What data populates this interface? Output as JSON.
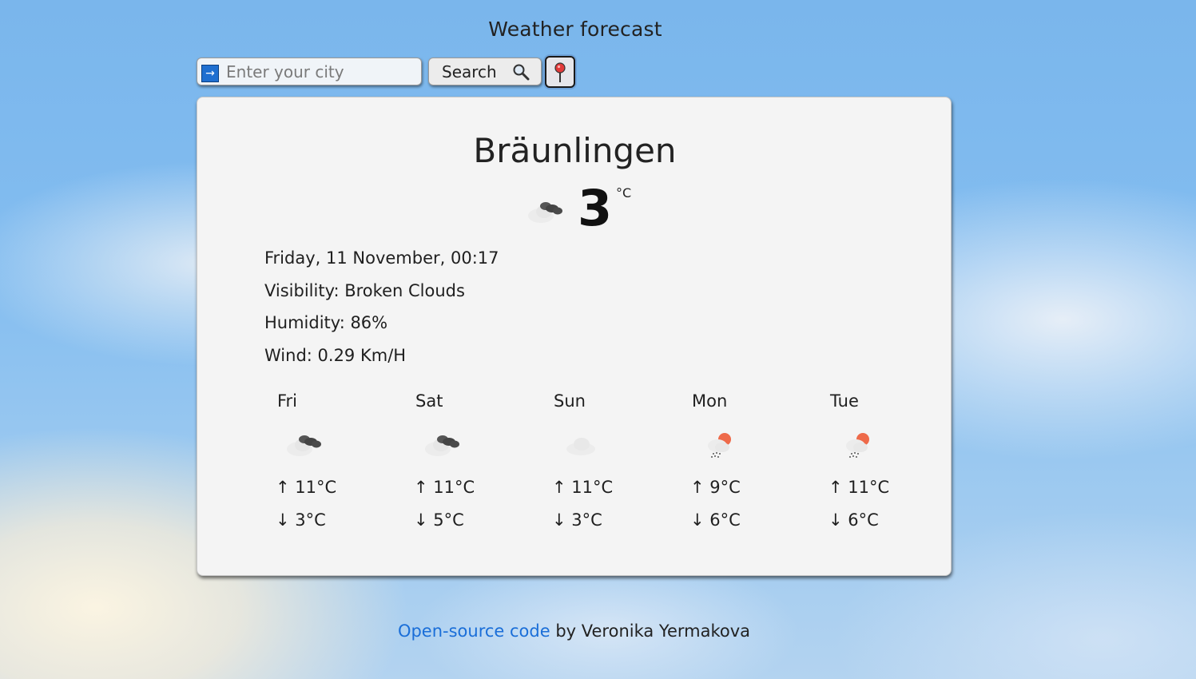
{
  "header": {
    "title": "Weather forecast"
  },
  "search": {
    "placeholder": "Enter your city",
    "value": "",
    "button_label": "Search",
    "enter_icon": "arrow-right-icon",
    "search_icon": "magnifier-icon",
    "location_icon": "location-pin-icon"
  },
  "current": {
    "city": "Bräunlingen",
    "temperature": "3",
    "unit": "°C",
    "icon": "broken-clouds-icon",
    "date": "Friday, 11 November, 00:17",
    "visibility": "Visibility: Broken Clouds",
    "humidity": "Humidity: 86%",
    "wind": "Wind: 0.29 Km/H"
  },
  "forecast": [
    {
      "day": "Fri",
      "icon": "broken-clouds-icon",
      "high": "↑ 11°C",
      "low": "↓ 3°C"
    },
    {
      "day": "Sat",
      "icon": "broken-clouds-icon",
      "high": "↑ 11°C",
      "low": "↓ 5°C"
    },
    {
      "day": "Sun",
      "icon": "cloud-icon",
      "high": "↑ 11°C",
      "low": "↓ 3°C"
    },
    {
      "day": "Mon",
      "icon": "sun-rain-icon",
      "high": "↑ 9°C",
      "low": "↓ 6°C"
    },
    {
      "day": "Tue",
      "icon": "sun-rain-icon",
      "high": "↑ 11°C",
      "low": "↓ 6°C"
    }
  ],
  "footer": {
    "link_text": "Open-source code",
    "suffix": " by Veronika Yermakova"
  },
  "colors": {
    "link": "#1a6ed8",
    "card_background": "#f4f4f4",
    "sun": "#ee6a4a",
    "dark_cloud": "#444444"
  }
}
